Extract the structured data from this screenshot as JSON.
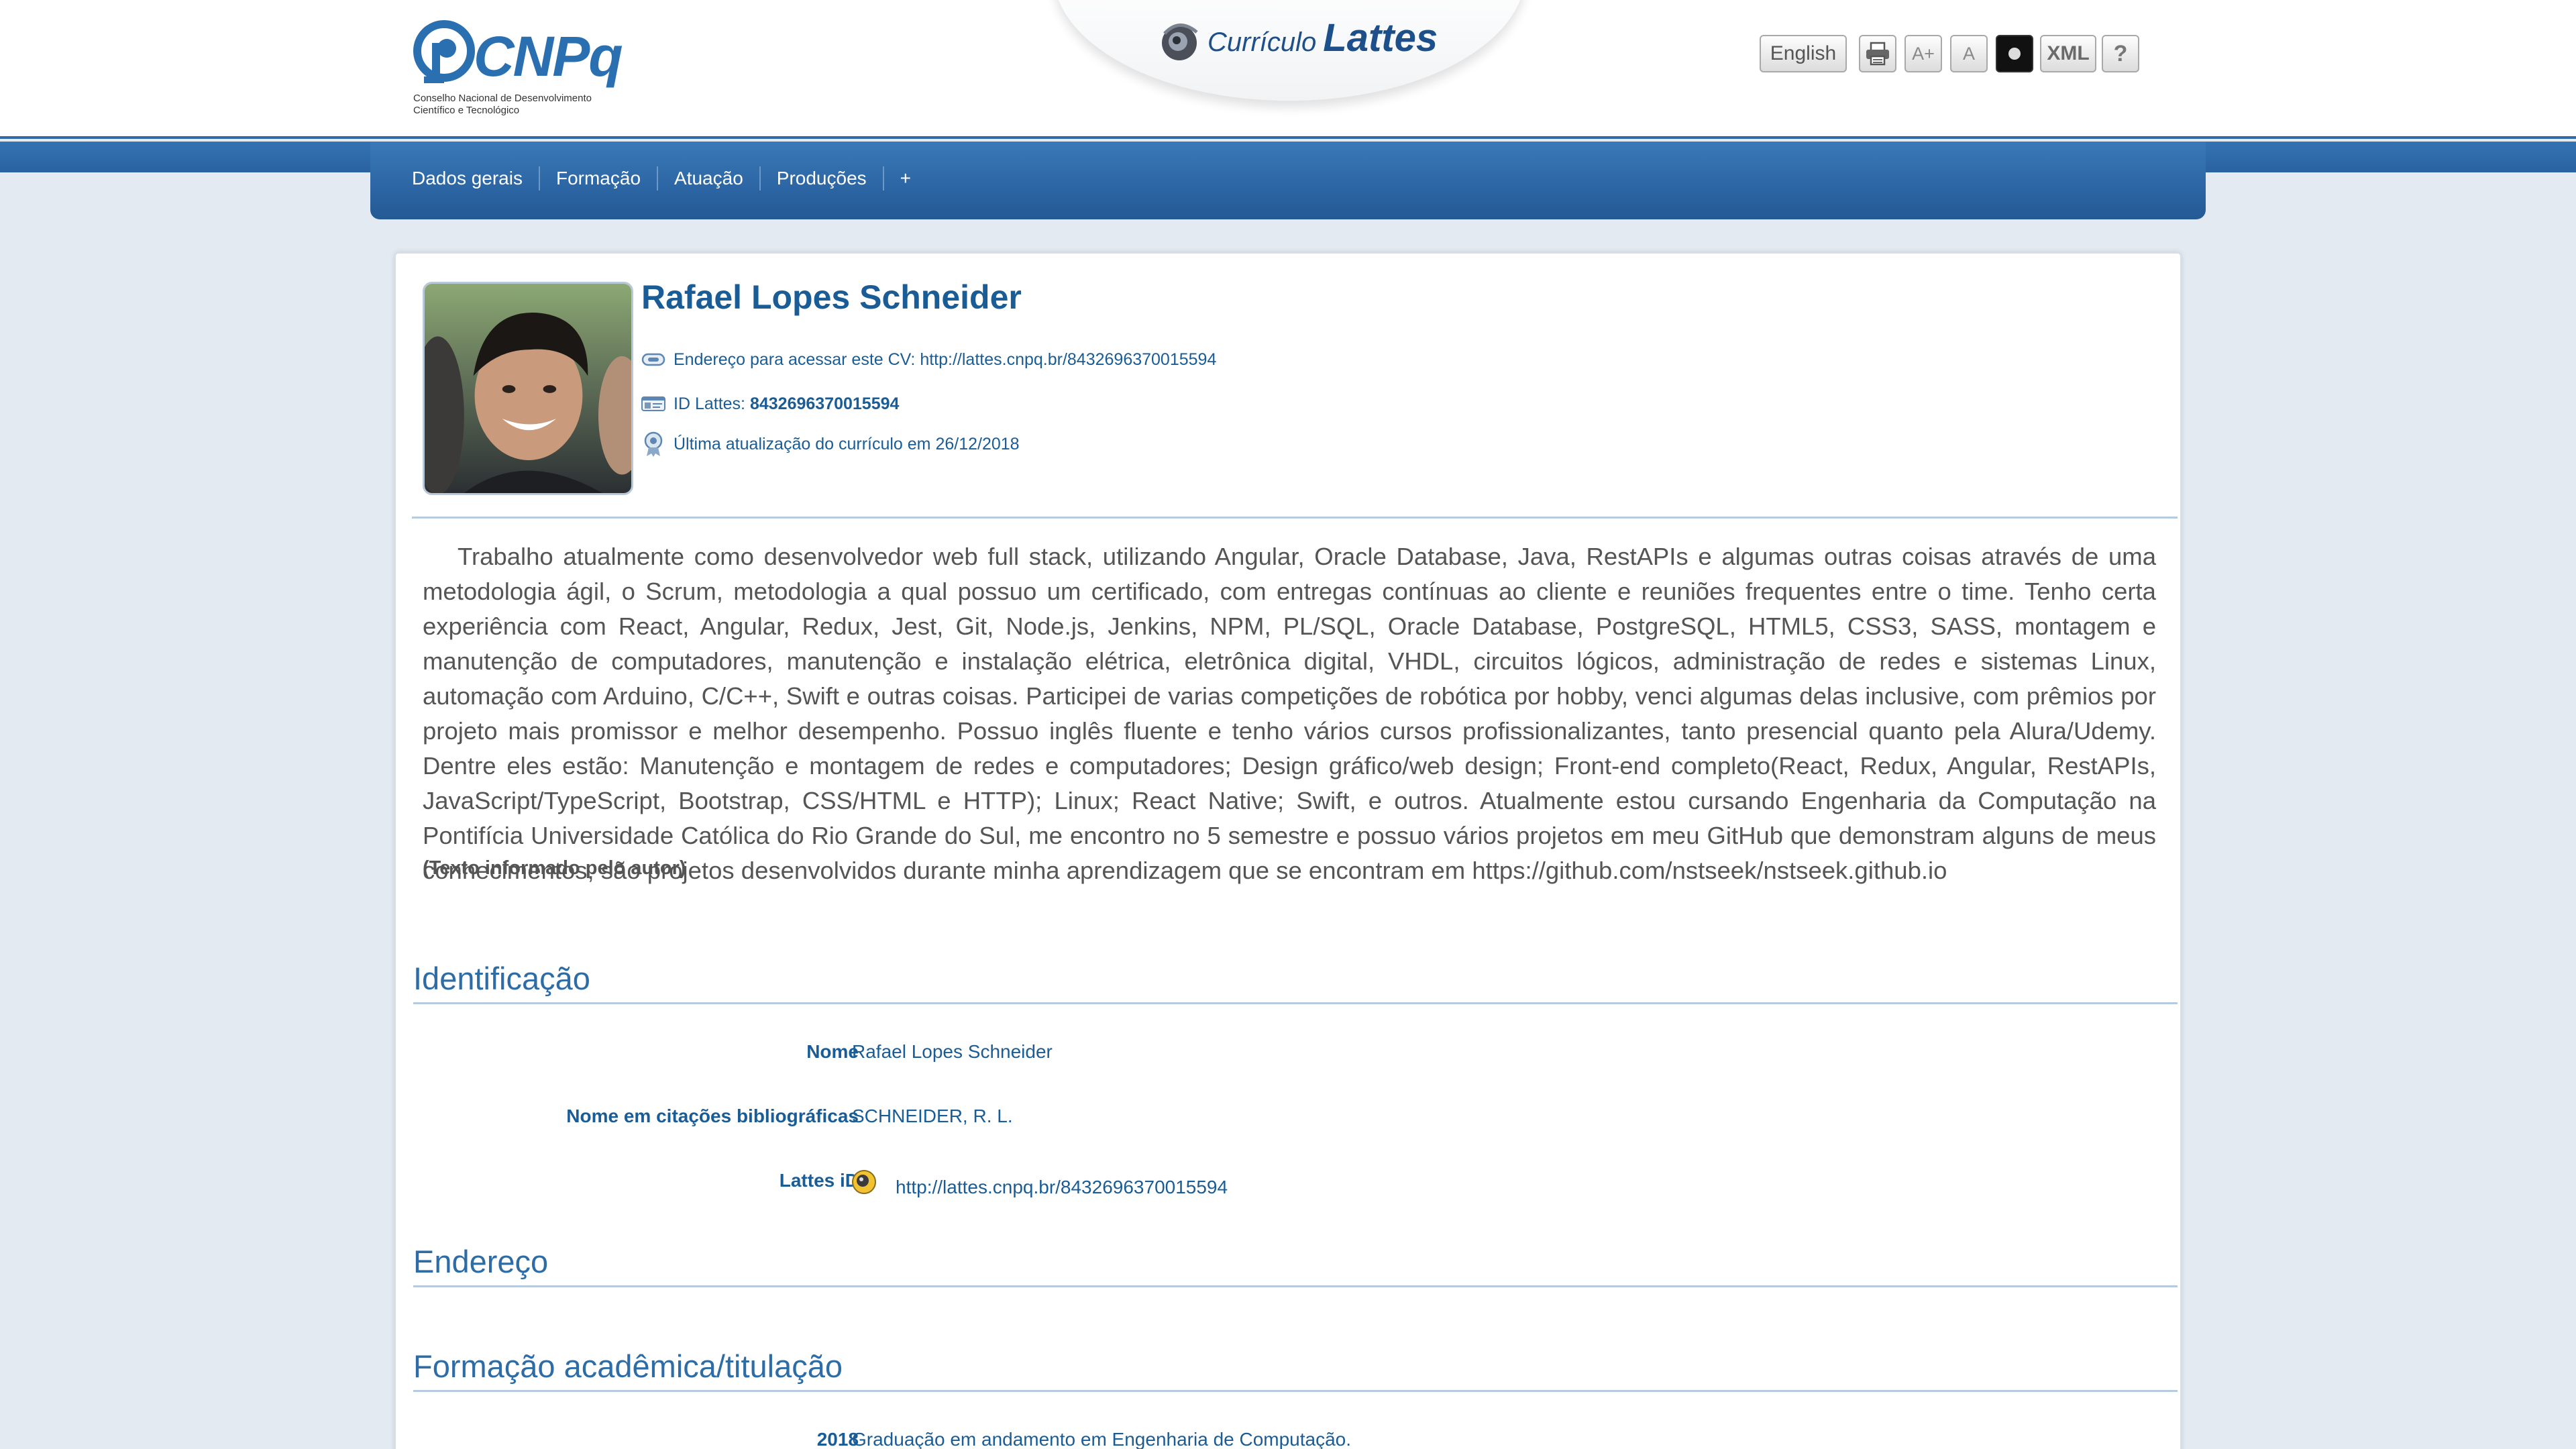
{
  "header": {
    "logo_name": "CNPq",
    "logo_subtitle_line1": "Conselho Nacional de Desenvolvimento",
    "logo_subtitle_line2": "Científico e Tecnológico",
    "brand_small": "Currículo",
    "brand_big": "Lattes",
    "tools": {
      "language_label": "English",
      "font_increase_label": "A+",
      "font_default_label": "A",
      "xml_label": "XML",
      "help_label": "?",
      "icons": [
        "print-icon",
        "contrast-icon"
      ]
    }
  },
  "nav": {
    "items": [
      "Dados gerais",
      "Formação",
      "Atuação",
      "Produções",
      "+"
    ]
  },
  "profile": {
    "name": "Rafael Lopes Schneider",
    "cv_address_label": "Endereço para acessar este CV: ",
    "cv_address_url": "http://lattes.cnpq.br/8432696370015594",
    "id_label": "ID Lattes: ",
    "id_value": "8432696370015594",
    "last_update": "Última atualização do currículo em 26/12/2018"
  },
  "bio": {
    "text": "Trabalho atualmente como desenvolvedor web full stack, utilizando Angular, Oracle Database, Java, RestAPIs e algumas outras coisas através de uma metodologia ágil, o Scrum, metodologia a qual possuo um certificado, com entregas contínuas ao cliente e reuniões frequentes entre o time. Tenho certa experiência com React, Angular, Redux, Jest, Git, Node.js, Jenkins, NPM, PL/SQL, Oracle Database, PostgreSQL, HTML5, CSS3, SASS, montagem e manutenção de computadores, manutenção e instalação elétrica, eletrônica digital, VHDL, circuitos lógicos, administração de redes e sistemas Linux, automação com Arduino, C/C++, Swift e outras coisas. Participei de varias competições de robótica por hobby, venci algumas delas inclusive, com prêmios por projeto mais promissor e melhor desempenho. Possuo inglês fluente e tenho vários cursos profissionalizantes, tanto presencial quanto pela Alura/Udemy. Dentre eles estão: Manutenção e montagem de redes e computadores; Design gráfico/web design; Front-end completo(React, Redux, Angular, RestAPIs, JavaScript/TypeScript, Bootstrap, CSS/HTML e HTTP); Linux; React Native; Swift, e outros. Atualmente estou cursando Engenharia da Computação na Pontifícia Universidade Católica do Rio Grande do Sul, me encontro no 5 semestre e possuo vários projetos em meu GitHub que demonstram alguns de meus conhecimentos, são projetos desenvolvidos durante minha aprendizagem que se encontram em https://github.com/nstseek/nstseek.github.io",
    "note": "(Texto informado pelo autor)"
  },
  "identificacao": {
    "title": "Identificação",
    "fields": [
      {
        "label": "Nome",
        "value": "Rafael Lopes Schneider"
      },
      {
        "label": "Nome em citações bibliográficas",
        "value": "SCHNEIDER, R. L."
      },
      {
        "label": "Lattes iD",
        "value": "http://lattes.cnpq.br/8432696370015594"
      }
    ]
  },
  "endereco": {
    "title": "Endereço"
  },
  "formacao": {
    "title": "Formação acadêmica/titulação",
    "items": [
      {
        "year": "2018",
        "text": "Graduação em andamento em Engenharia de Computação."
      }
    ]
  },
  "colors": {
    "nav_blue": "#2a62a0",
    "title_blue": "#1a5c95",
    "section_blue": "#2e6ca6",
    "page_bg": "#e3eaf1"
  }
}
